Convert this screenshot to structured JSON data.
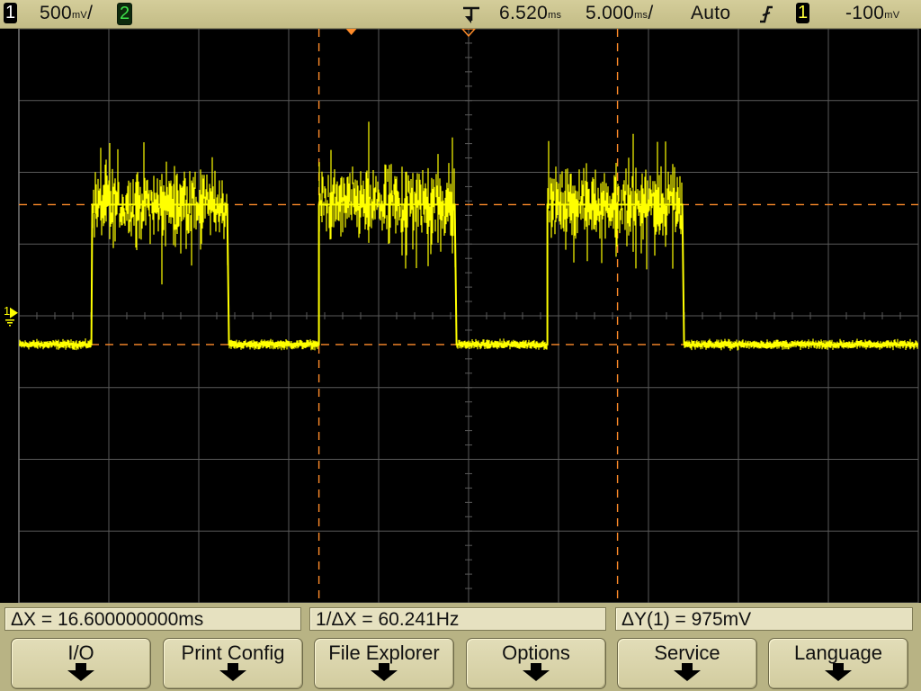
{
  "colors": {
    "status_bar": "#c9c28d",
    "trace": "#ffff00",
    "cursor": "#ff8c2a",
    "grid": "#5a5a5a",
    "ch2_badge": "#3ee24a"
  },
  "status_bar": {
    "ch1_badge": "1",
    "ch1_scale": "500",
    "ch1_scale_unit": "mV",
    "ch2_badge": "2",
    "trigger_position_icon": "trigger-point-arrow-icon",
    "delay": "6.520",
    "delay_unit": "ms",
    "timebase": "5.000",
    "timebase_unit": "ms",
    "trigger_mode": "Auto",
    "trigger_slope_icon": "rising-edge-icon",
    "trigger_source_badge": "1",
    "trigger_level": "-100",
    "trigger_level_unit": "mV"
  },
  "screen": {
    "ground_marker_label": "1",
    "ground_marker_icon": "ground-marker-icon"
  },
  "chart_data": {
    "type": "line",
    "title": "",
    "xlabel": "",
    "ylabel": "",
    "x_units": "ms",
    "y_units": "V",
    "xlim": [
      -18.48,
      31.52
    ],
    "ylim": [
      -1.8,
      2.2
    ],
    "grid": true,
    "grid_divisions": {
      "x": 10,
      "y": 8
    },
    "series": [
      {
        "name": "",
        "x": [
          -18.48,
          -14.45,
          -14.4,
          -6.9,
          -6.8,
          -1.8,
          -1.8,
          5.75,
          5.85,
          10.9,
          10.9,
          18.4,
          18.5,
          31.52
        ],
        "y": [
          0.0,
          0.0,
          0.975,
          0.975,
          0.0,
          0.0,
          0.975,
          0.975,
          0.0,
          0.0,
          0.975,
          0.975,
          0.0,
          0.0
        ],
        "noise_low_v": 0.03,
        "noise_high_v": 0.3
      }
    ],
    "cursors": {
      "x1_ms": -1.8,
      "x2_ms": 14.8,
      "y1_v": 0.0,
      "y2_v": 0.975
    },
    "markers": {
      "trigger_time_ms": 0.0,
      "delay_reference_ms": 6.52,
      "ground_level_v": 0.22
    }
  },
  "measurements": {
    "delta_x": "ΔX = 16.600000000ms",
    "inv_delta_x": "1/ΔX = 60.241Hz",
    "delta_y": "ΔY(1) = 975mV"
  },
  "softkeys": [
    {
      "label": "I/O",
      "icon": "down-arrow-icon"
    },
    {
      "label": "Print Config",
      "icon": "down-arrow-icon"
    },
    {
      "label": "File Explorer",
      "icon": "down-arrow-icon"
    },
    {
      "label": "Options",
      "icon": "down-arrow-icon"
    },
    {
      "label": "Service",
      "icon": "down-arrow-icon"
    },
    {
      "label": "Language",
      "icon": "down-arrow-icon"
    }
  ]
}
